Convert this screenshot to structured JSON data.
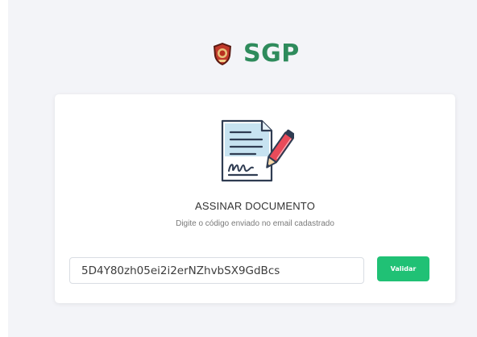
{
  "brand": {
    "name": "SGP",
    "logo_icon": "shield-emblem-icon",
    "color": "#2e8b5c"
  },
  "card": {
    "icon": "signed-document-icon",
    "title": "ASSINAR DOCUMENTO",
    "subtitle": "Digite o código enviado no email cadastrado"
  },
  "form": {
    "code_value": "5D4Y80zh05ei2i2erNZhvbSX9GdBcs",
    "validate_label": "Validar",
    "validate_color": "#20c175"
  },
  "colors": {
    "page_background": "#f3f4f8",
    "card_background": "#ffffff",
    "icon_outline": "#2f3c52",
    "icon_accent": "#e94b5a",
    "icon_paper_fill": "#c7e3f1"
  }
}
